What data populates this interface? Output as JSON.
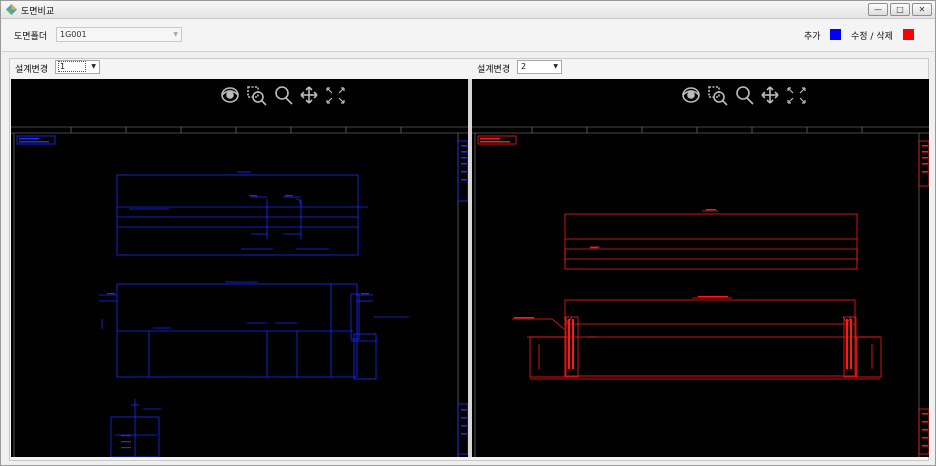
{
  "window": {
    "title": "도면비교",
    "minimize_glyph": "—",
    "maximize_glyph": "□",
    "close_glyph": "✕"
  },
  "toolbar": {
    "folder_label": "도면폴더",
    "folder_value": "1G001",
    "legend_add_label": "추가",
    "legend_add_color": "#0000ff",
    "legend_edit_label": "수정 / 삭제",
    "legend_edit_color": "#ff0000"
  },
  "left_view": {
    "revision_label": "설계변경",
    "revision_value": "1",
    "drawing_color": "#1a2cff"
  },
  "right_view": {
    "revision_label": "설계변경",
    "revision_value": "2",
    "drawing_color": "#ff1a1a"
  },
  "viewer_tools": [
    "eye-icon",
    "zoom-window-icon",
    "zoom-icon",
    "pan-icon",
    "fit-icon"
  ]
}
